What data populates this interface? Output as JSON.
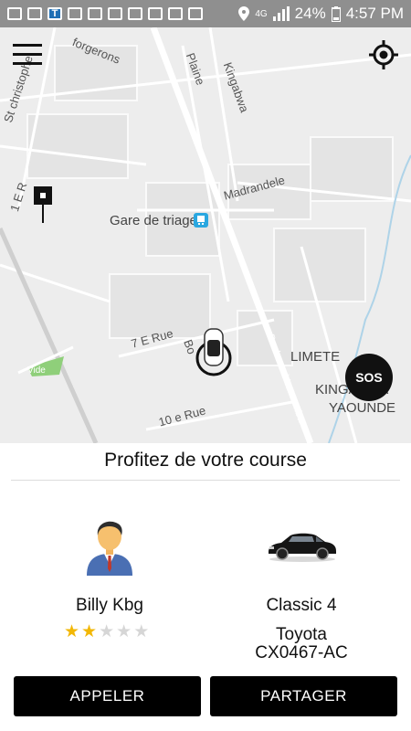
{
  "status_bar": {
    "t_icon": "T",
    "network": "4G",
    "battery": "24%",
    "time": "4:57 PM",
    "icons": [
      "message-icon",
      "image-icon",
      "t-app-icon",
      "sim-icon",
      "pause-icon",
      "weather-icon",
      "flipboard-icon",
      "flipboard-icon",
      "mail-icon",
      "map-icon",
      "location-icon",
      "signal-icon",
      "battery-icon"
    ]
  },
  "map": {
    "labels": {
      "forgerons": "forgerons",
      "st_christophe": "St christophe",
      "plaine": "Plaine",
      "kingabwa": "Kingabwa",
      "e_rue_1": "1 E R",
      "madrandele": "Madrandele",
      "gare": "Gare de triage",
      "rue_7": "7 E Rue",
      "bo": "Bo",
      "boulevard": "Boulevard Lumumba",
      "limete": "LIMETE",
      "kingabwa_bottom": "KINGABWA",
      "yaounde": "YAOUNDE",
      "rue_10": "10 e Rue",
      "vide": "Vide"
    }
  },
  "controls": {
    "menu_icon": "hamburger-menu-icon",
    "locate_icon": "crosshair-location-icon",
    "sos_label": "SOS"
  },
  "trip_panel": {
    "title": "Profitez de votre course",
    "driver": {
      "name": "Billy  Kbg",
      "rating": 2,
      "max_rating": 5
    },
    "vehicle": {
      "class": "Classic 4",
      "make": "Toyota",
      "plate": "CX0467-AC"
    },
    "buttons": {
      "call": "APPELER",
      "share": "PARTAGER"
    }
  }
}
